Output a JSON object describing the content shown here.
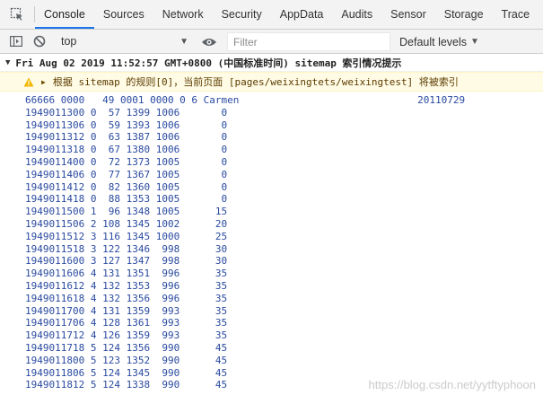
{
  "tabs": [
    {
      "label": "Console",
      "active": true
    },
    {
      "label": "Sources",
      "active": false
    },
    {
      "label": "Network",
      "active": false
    },
    {
      "label": "Security",
      "active": false
    },
    {
      "label": "AppData",
      "active": false
    },
    {
      "label": "Audits",
      "active": false
    },
    {
      "label": "Sensor",
      "active": false
    },
    {
      "label": "Storage",
      "active": false
    },
    {
      "label": "Trace",
      "active": false
    }
  ],
  "toolbar": {
    "context": "top",
    "filter_placeholder": "Filter",
    "levels": "Default levels"
  },
  "console": {
    "group_title": "Fri Aug 02 2019 11:52:57 GMT+0800 (中国标准时间) sitemap 索引情况提示",
    "warning": "根据 sitemap 的规则[0]，当前页面 [pages/weixingtets/weixingtest] 将被索引",
    "lines": [
      "66666 0000   49 0001 0000 0 6 Carmen                              20110729",
      "1949011300 0  57 1399 1006       0",
      "1949011306 0  59 1393 1006       0",
      "1949011312 0  63 1387 1006       0",
      "1949011318 0  67 1380 1006       0",
      "1949011400 0  72 1373 1005       0",
      "1949011406 0  77 1367 1005       0",
      "1949011412 0  82 1360 1005       0",
      "1949011418 0  88 1353 1005       0",
      "1949011500 1  96 1348 1005      15",
      "1949011506 2 108 1345 1002      20",
      "1949011512 3 116 1345 1000      25",
      "1949011518 3 122 1346  998      30",
      "1949011600 3 127 1347  998      30",
      "1949011606 4 131 1351  996      35",
      "1949011612 4 132 1353  996      35",
      "1949011618 4 132 1356  996      35",
      "1949011700 4 131 1359  993      35",
      "1949011706 4 128 1361  993      35",
      "1949011712 4 126 1359  993      35",
      "1949011718 5 124 1356  990      45",
      "1949011800 5 123 1352  990      45",
      "1949011806 5 124 1345  990      45",
      "1949011812 5 124 1338  990      45"
    ]
  },
  "watermark": "https://blog.csdn.net/yytftyphoon",
  "colors": {
    "accent": "#1a73e8",
    "warning_bg": "#fffbe5",
    "log_text": "#2a4aa0"
  }
}
